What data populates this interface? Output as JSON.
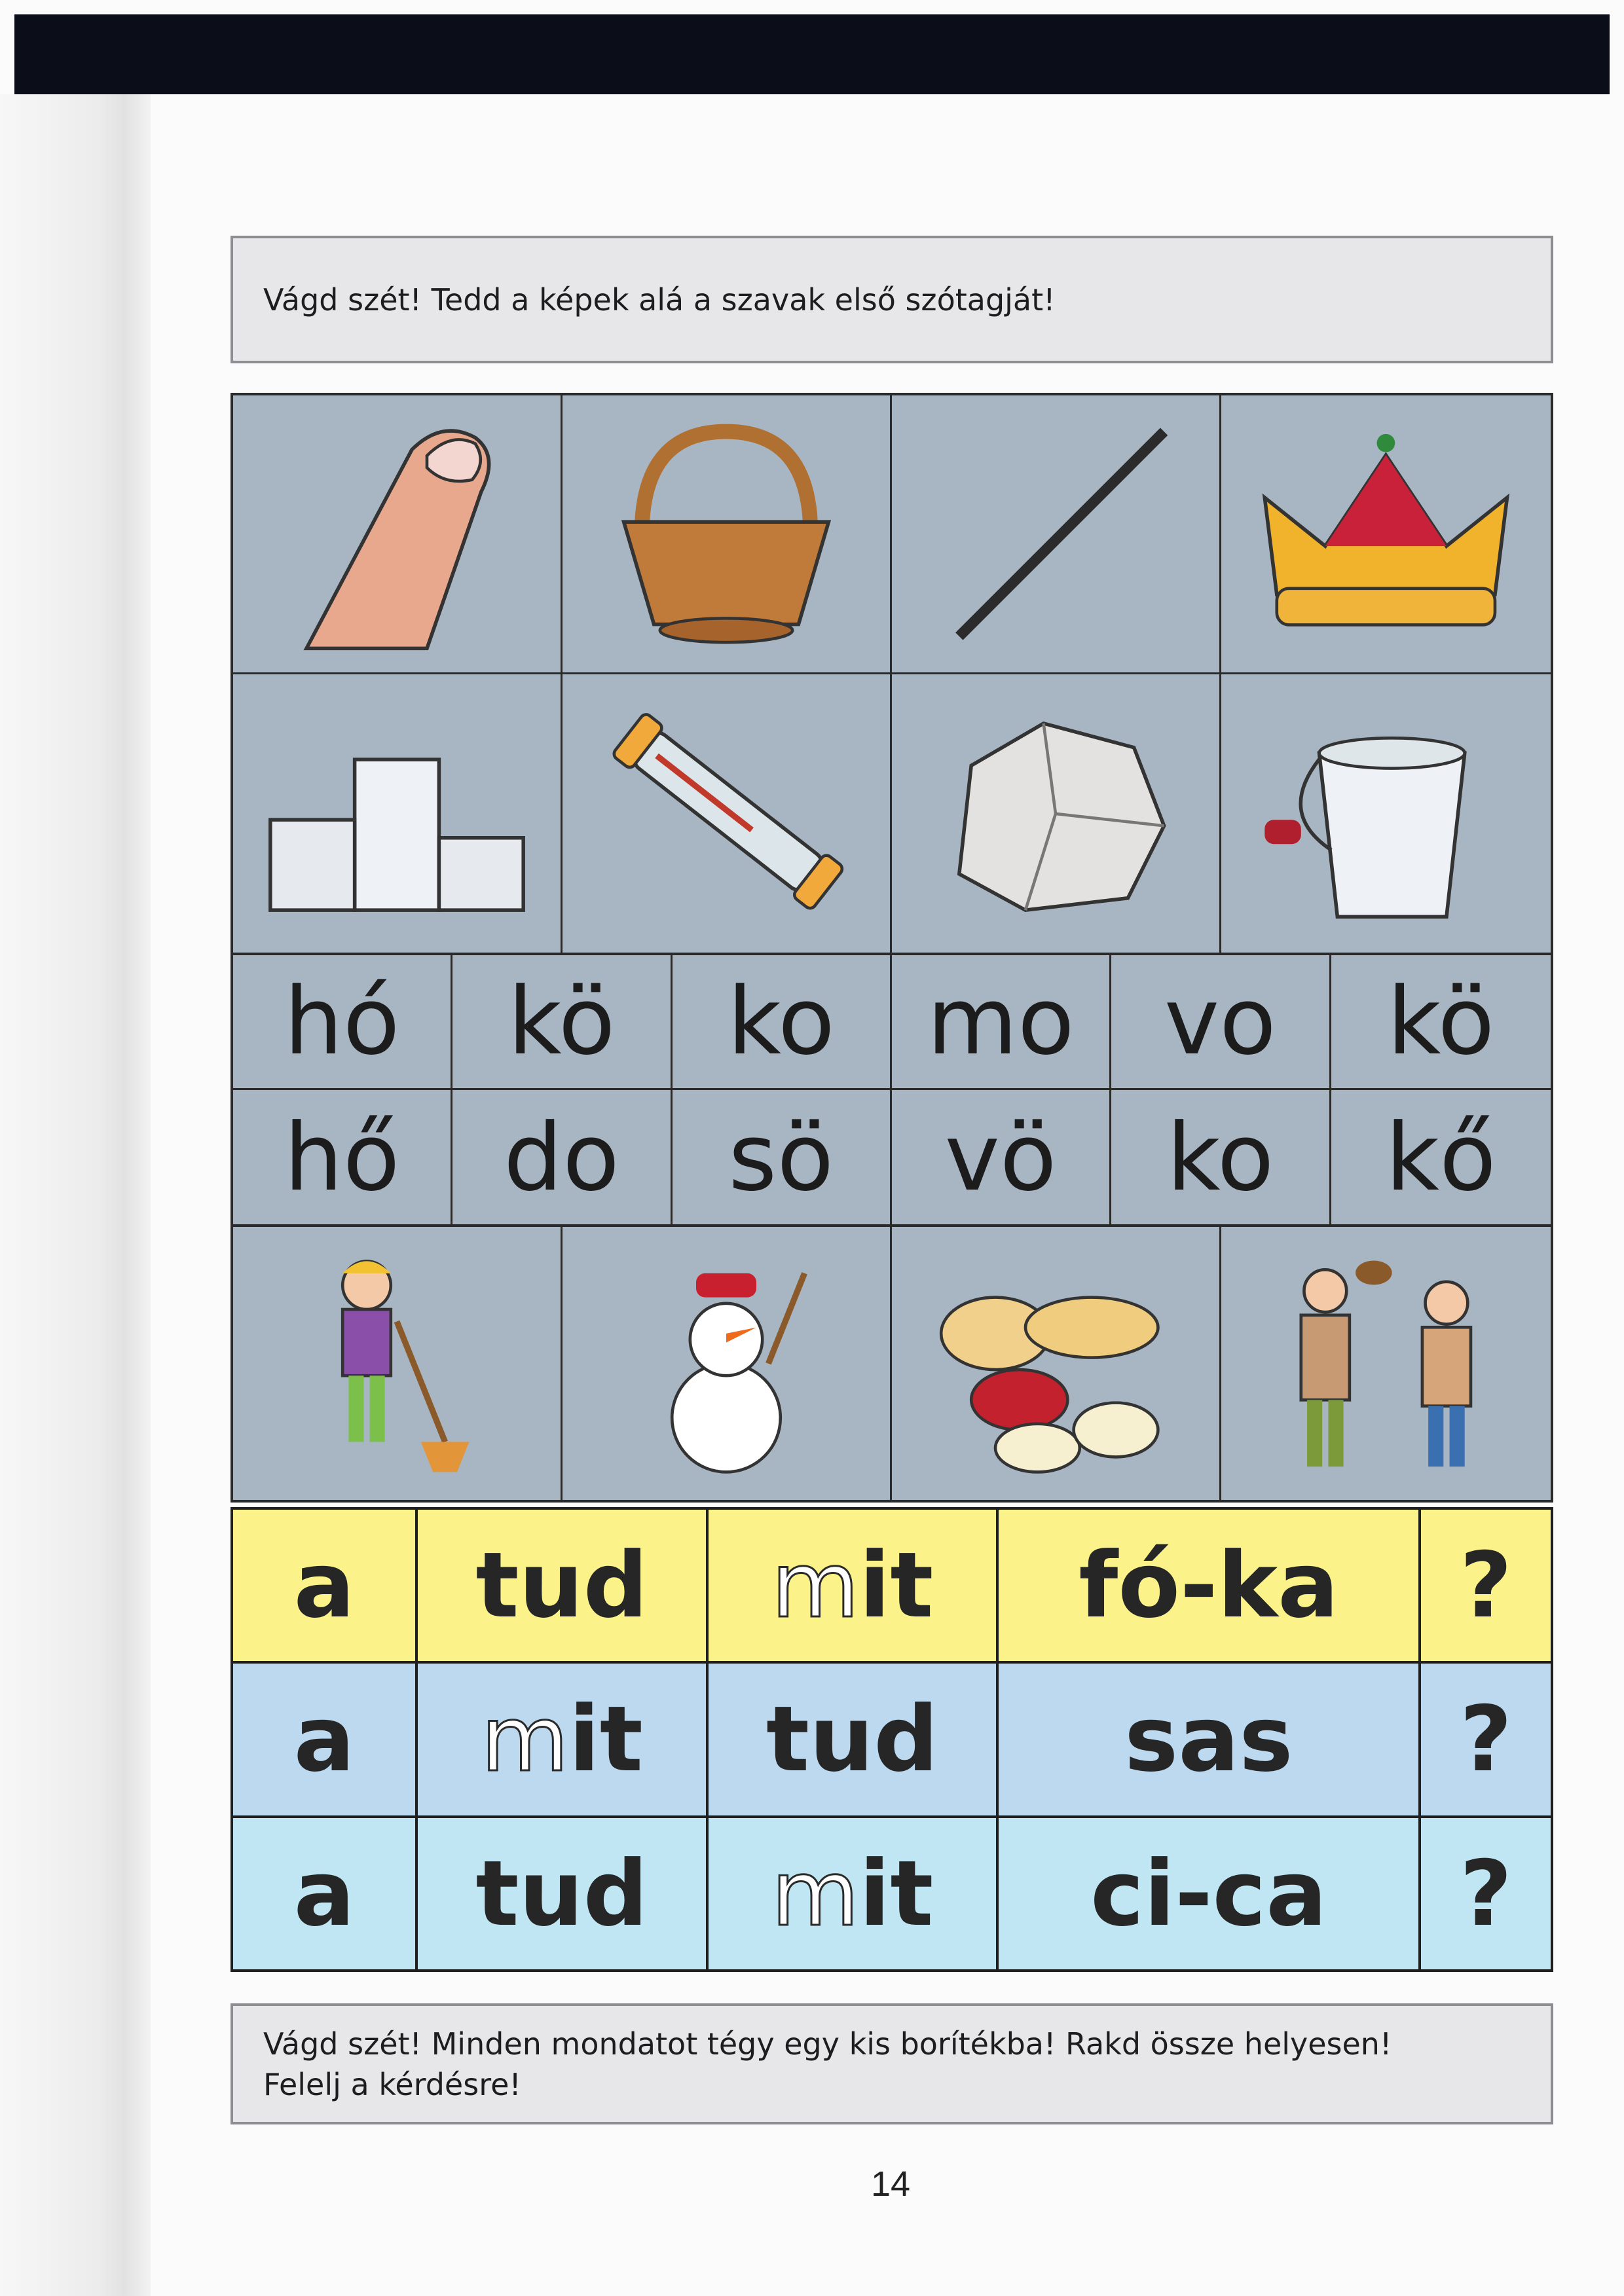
{
  "instructions": {
    "top": "Vágd szét! Tedd a képek alá a szavak első szótagját!",
    "bottom_line1": "Vágd szét! Minden mondatot tégy egy kis borítékba! Rakd össze helyesen!",
    "bottom_line2": "Felelj a kérdésre!"
  },
  "pictures_top": [
    {
      "icon": "finger-icon"
    },
    {
      "icon": "basket-icon"
    },
    {
      "icon": "stick-icon"
    },
    {
      "icon": "crown-icon"
    },
    {
      "icon": "podium-icon"
    },
    {
      "icon": "thermometer-icon"
    },
    {
      "icon": "rock-icon"
    },
    {
      "icon": "bucket-icon"
    }
  ],
  "syllables": {
    "row1": [
      "hó",
      "kö",
      "ko",
      "mo",
      "vo",
      "kö"
    ],
    "row2": [
      "hő",
      "do",
      "sö",
      "vö",
      "ko",
      "kő"
    ]
  },
  "pictures_bottom": [
    {
      "icon": "girl-sweeping-icon"
    },
    {
      "icon": "snowman-icon"
    },
    {
      "icon": "nuts-icon"
    },
    {
      "icon": "men-greeting-icon"
    }
  ],
  "sentences": [
    {
      "c1": "a",
      "c2": {
        "pre": "",
        "m": "",
        "rest": "tud"
      },
      "c3": {
        "m": "m",
        "rest": "it"
      },
      "c4": "fó-ka",
      "c5": "?"
    },
    {
      "c1": "a",
      "c2": {
        "m": "m",
        "rest": "it"
      },
      "c3": {
        "m": "",
        "rest": "tud"
      },
      "c4": "sas",
      "c5": "?"
    },
    {
      "c1": "a",
      "c2": {
        "m": "",
        "rest": "tud"
      },
      "c3": {
        "m": "m",
        "rest": "it"
      },
      "c4": "ci-ca",
      "c5": "?"
    }
  ],
  "page_number": "14"
}
